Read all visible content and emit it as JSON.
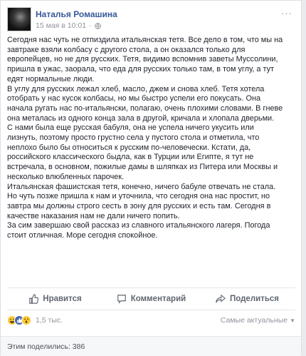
{
  "post": {
    "author": "Наталья Ромашина",
    "timestamp": "15 мая в 10:01",
    "more_label": "···",
    "paragraphs": [
      "Сегодня нас чуть не отпиздила итальянская тетя. Все дело в том, что мы на завтраке взяли колбасу с другого стола, а он оказался только для европейцев, но не для русских. Тетя, видимо вспомнив заветы Муссолини, пришла в ужас, заорала, что еда для русских только там, в том углу, а тут едят нормальные люди.",
      "В углу для русских лежал хлеб, масло, джем и снова хлеб. Тетя хотела отобрать у нас кусок колбасы, но мы быстро успели его покусать. Она начала ругать нас по-итальянски, полагаю, очень плохими словами. В гневе она металась из одного конца зала в другой, кричала и хлопала дверьми.",
      "С нами была еще русская бабуля, она не успела ничего укусить или лизнуть, поэтому просто грустно села у пустого стола и отметила, что неплохо было бы относиться к русским по-человечески. Кстати, да, российского классического быдла, как в Турции или Египте, я тут не встречала, в основном, пожилые дамы в шляпках из Питера или Москвы и несколько влюбленных парочек.",
      "Итальянская фашистская тетя, конечно, ничего бабуле отвечать не стала. Но чуть позже пришла к нам и уточнила, что сегодня она нас простит, но завтра мы должны строго сесть в зону для русских и есть там. Сегодня в качестве наказания нам не дали ничего попить.",
      "За сим завершаю свой рассказ из славного итальянского лагеря. Погода стоит отличная. Море сегодня спокойное."
    ]
  },
  "actions": {
    "like": "Нравится",
    "comment": "Комментарий",
    "share": "Поделиться"
  },
  "reactions": {
    "count": "1,5 тыс.",
    "sort_label": "Самые актуальные",
    "icons": [
      "haha-icon",
      "like-icon",
      "wow-icon"
    ]
  },
  "footer": {
    "seen_label": "Этим поделились: 386"
  },
  "colors": {
    "author": "#365899",
    "muted": "#90949c",
    "action": "#606770"
  }
}
